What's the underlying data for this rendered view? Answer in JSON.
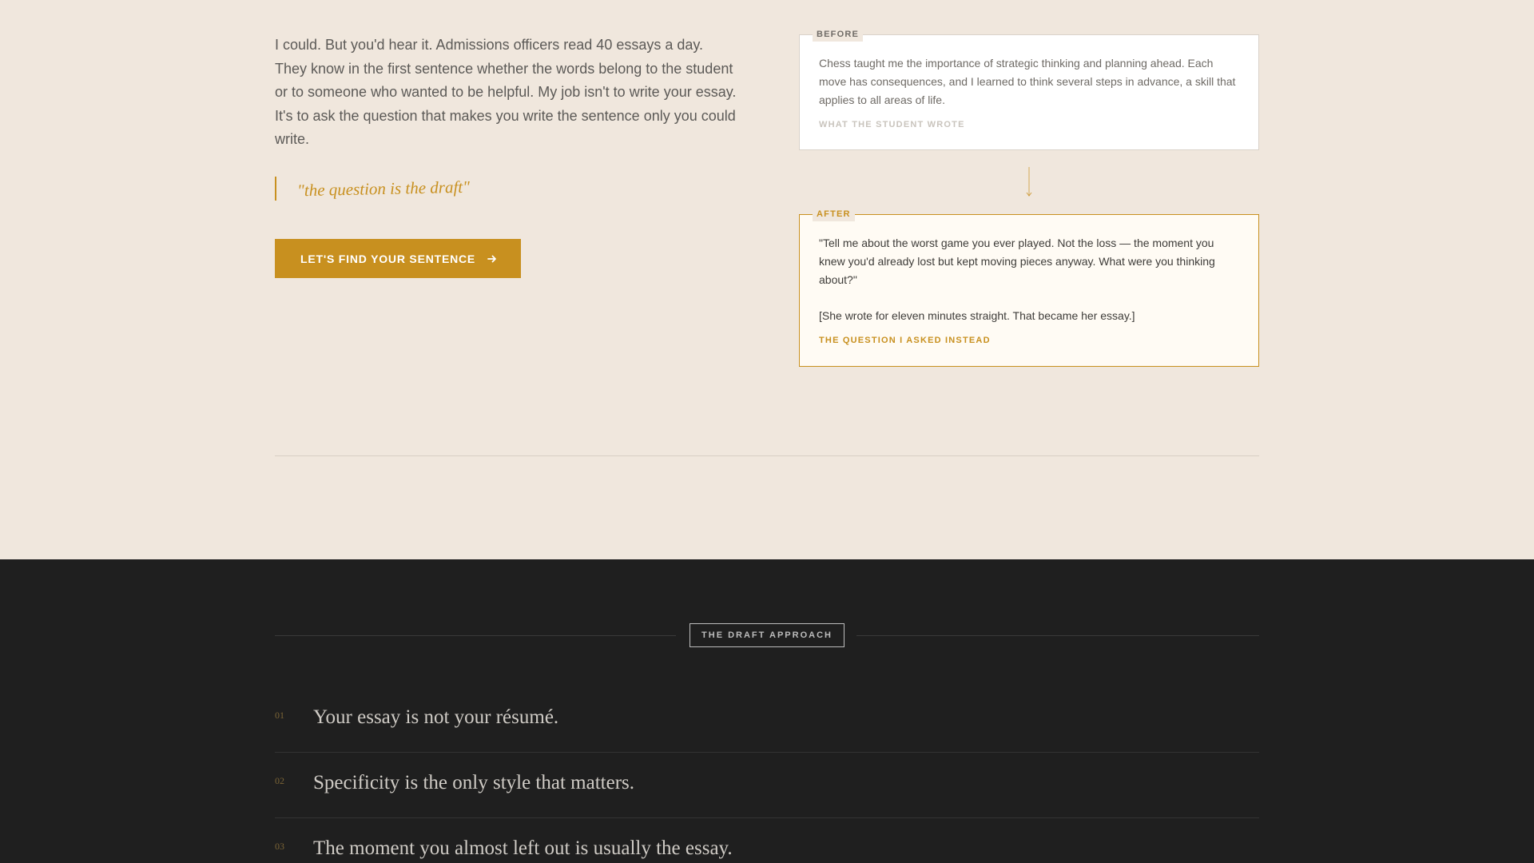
{
  "intro": {
    "lead": "I could. But you'd hear it. Admissions officers read 40 essays a day. They know in the first sentence whether the words belong to the student or to someone who wanted to be helpful. My job isn't to write your essay. It's to ask the question that makes you write the sentence only you could write.",
    "quote": "\"the question is the draft\"",
    "cta_label": "LET'S FIND YOUR SENTENCE",
    "cta_icon": "arrow-right-icon"
  },
  "before_card": {
    "tag": "BEFORE",
    "text": "Chess taught me the importance of strategic thinking and planning ahead. Each move has consequences, and I learned to think several steps in advance, a skill that applies to all areas of life.",
    "caption": "WHAT THE STUDENT WROTE"
  },
  "after_card": {
    "tag": "AFTER",
    "text": "\"Tell me about the worst game you ever played. Not the loss — the moment you knew you'd already lost but kept moving pieces anyway. What were you thinking about?\"",
    "note": "[She wrote for eleven minutes straight. That became her essay.]",
    "caption": "THE QUESTION I ASKED INSTEAD"
  },
  "approach": {
    "label": "THE DRAFT APPROACH",
    "items": [
      {
        "num": "01",
        "text": "Your essay is not your résumé."
      },
      {
        "num": "02",
        "text": "Specificity is the only style that matters."
      },
      {
        "num": "03",
        "text": "The moment you almost left out is usually the essay."
      }
    ]
  },
  "colors": {
    "accent": "#c8901f",
    "background_light": "#f0e7dd",
    "background_dark": "#1f1f1f"
  }
}
